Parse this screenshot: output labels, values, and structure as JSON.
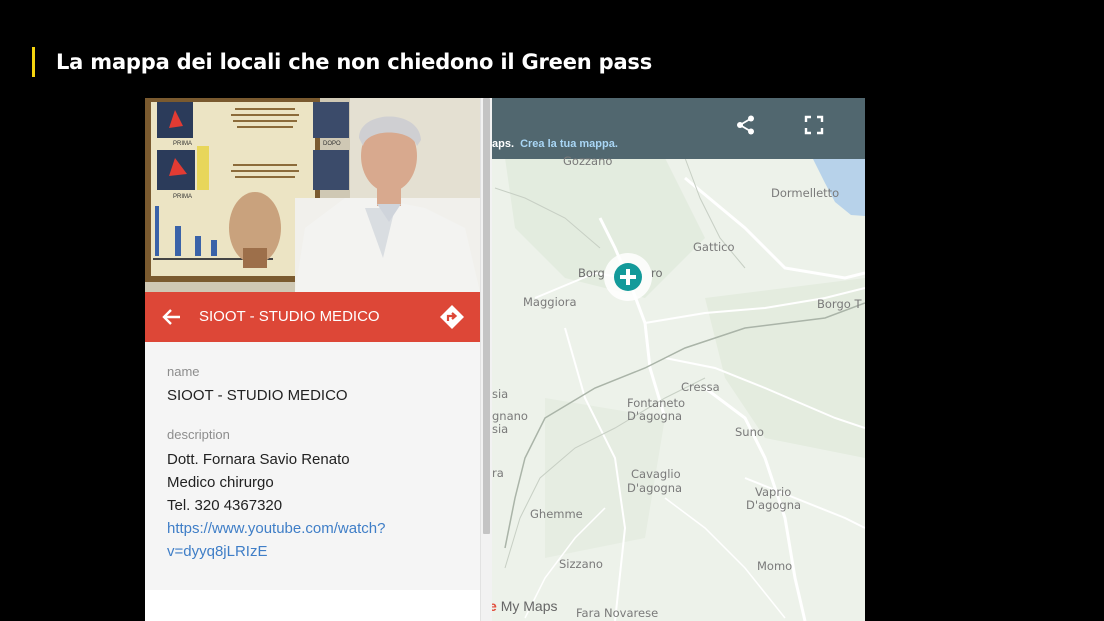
{
  "page": {
    "title": "La mappa dei locali che non chiedono il Green pass"
  },
  "map": {
    "links_text": "aps.",
    "create_link": "Crea la tua mappa.",
    "brand_fragment": "e",
    "brand_text": "My Maps",
    "share_icon": "share-icon",
    "fullscreen_icon": "fullscreen-icon",
    "marker_icon": "medical-cross-icon",
    "places": {
      "gozzano": "Gozzano",
      "dormelletto": "Dormelletto",
      "gattico": "Gattico",
      "borgo_left": "Borg",
      "borgo_right": "ro",
      "maggiora": "Maggiora",
      "borgo_t": "Borgo T",
      "cressa": "Cressa",
      "fontaneto_1": "Fontaneto",
      "fontaneto_2": "D'agogna",
      "suno": "Suno",
      "sia": "sia",
      "gnano": "gnano",
      "sia2": "sia",
      "ra": "ra",
      "cavaglio_1": "Cavaglio",
      "cavaglio_2": "D'agogna",
      "vaprio_1": "Vaprio",
      "vaprio_2": "D'agogna",
      "ghemme": "Ghemme",
      "sizzano": "Sizzano",
      "momo": "Momo",
      "fara": "Fara Novarese"
    },
    "colors": {
      "topbar": "#51676f",
      "marker": "#139a9a"
    }
  },
  "panel": {
    "header_title": "SIOOT - STUDIO MEDICO",
    "header_color": "#dd4737",
    "back_icon": "arrow-left-icon",
    "directions_icon": "directions-icon",
    "name_label": "name",
    "name_value": "SIOOT - STUDIO MEDICO",
    "description_label": "description",
    "description_lines": [
      "Dott. Fornara Savio Renato",
      "Medico chirurgo",
      "Tel. 320 4367320"
    ],
    "link_line1": "https://www.youtube.com/watch?",
    "link_line2": "v=dyyq8jLRIzE",
    "poster": {
      "prima": "PRIMA",
      "dopo": "DOPO"
    }
  }
}
